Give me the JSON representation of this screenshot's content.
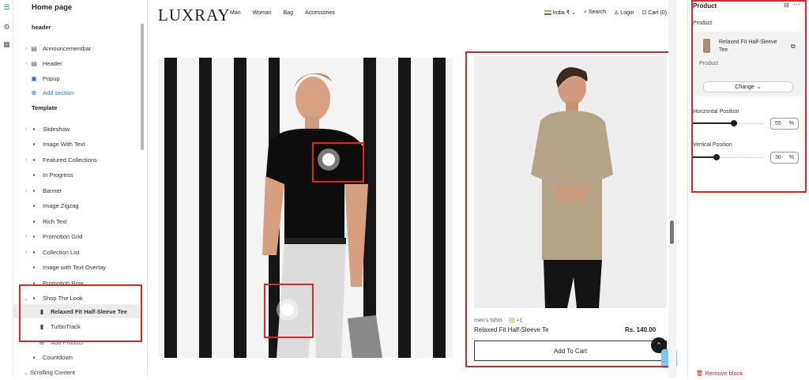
{
  "rail": {
    "icons": [
      "layout-icon",
      "gear-icon",
      "apps-icon"
    ]
  },
  "sidebar": {
    "title": "Home page",
    "header_section": "header",
    "header_items": [
      {
        "label": "Announcementbar",
        "chev": true,
        "icon": "announcement-icon"
      },
      {
        "label": "Header",
        "chev": true,
        "icon": "header-icon"
      },
      {
        "label": "Popup",
        "chev": false,
        "icon": "popup-icon"
      }
    ],
    "add_section": "Add section",
    "template_section": "Template",
    "template_items": [
      {
        "label": "Slideshow",
        "chev": true,
        "icon": "slideshow-icon"
      },
      {
        "label": "Image With Text",
        "chev": false,
        "icon": "image-text-icon"
      },
      {
        "label": "Featured Collections",
        "chev": true,
        "icon": "collections-icon"
      },
      {
        "label": "In Progress",
        "chev": false,
        "icon": "progress-icon"
      },
      {
        "label": "Banner",
        "chev": true,
        "icon": "banner-icon"
      },
      {
        "label": "Image Zigzag",
        "chev": false,
        "icon": "zigzag-icon"
      },
      {
        "label": "Rich Text",
        "chev": false,
        "icon": "rich-text-icon"
      },
      {
        "label": "Promotion Grid",
        "chev": true,
        "icon": "grid-icon"
      },
      {
        "label": "Collection List",
        "chev": true,
        "icon": "collection-list-icon"
      },
      {
        "label": "Image with Text Overlay",
        "chev": false,
        "icon": "overlay-icon"
      },
      {
        "label": "Promotion Row",
        "chev": false,
        "icon": "promotion-row-icon"
      },
      {
        "label": "Shop The Look",
        "chev": true,
        "icon": "shop-look-icon"
      }
    ],
    "shop_children": [
      {
        "label": "Relaxed Fit Half-Sleeve Tee",
        "icon": "tee-icon"
      },
      {
        "label": "TurboTrack",
        "icon": "turbotrack-icon"
      }
    ],
    "add_product": "Add Product",
    "after_items": [
      {
        "label": "Countdown",
        "chev": false,
        "icon": "countdown-icon"
      },
      {
        "label": "Scrolling Content",
        "chev": true,
        "icon": ""
      }
    ]
  },
  "preview": {
    "logo": "LUXRAY",
    "nav": [
      "Man",
      "Woman",
      "Bag",
      "Accessories"
    ],
    "region": "India ₹",
    "search": "Search",
    "login": "Login",
    "cart": "Cart (0)",
    "product_tag": "men's tshirt",
    "swatch_more": "+1",
    "product_name": "Relaxed Fit Half-Sleeve Te",
    "price": "Rs. 140.00",
    "add_to_cart": "Add To Cart",
    "hotspots": [
      {
        "name": "hotspot-chest",
        "h_pct": 58,
        "v_pct": 34
      },
      {
        "name": "hotspot-leg",
        "h_pct": 44,
        "v_pct": 84
      }
    ]
  },
  "right_panel": {
    "title": "Product",
    "product_label": "Product",
    "product_name": "Relaxed Fit Half-Sleeve Tee",
    "product_sub": "Product",
    "change_label": "Change",
    "h_label": "Horizontal Position",
    "h_value": "55",
    "v_label": "Vertical Position",
    "v_value": "30",
    "unit": "%",
    "remove_label": "Remove block"
  },
  "colors": {
    "accent_red": "#e0242a",
    "link_blue": "#2a6dc9"
  }
}
